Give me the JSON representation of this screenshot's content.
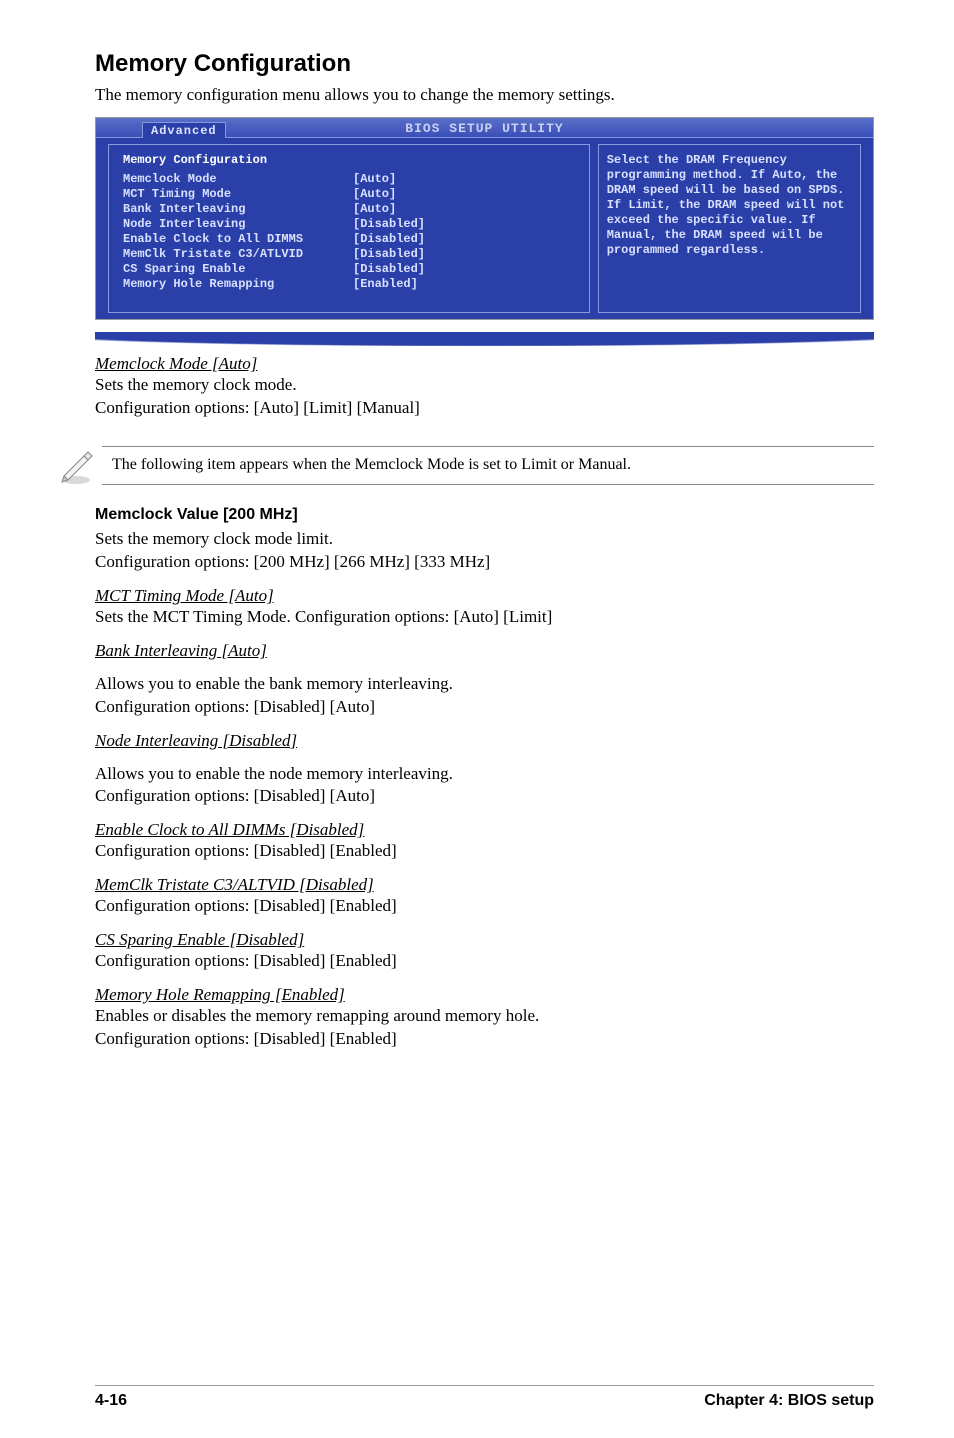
{
  "title": "Memory Configuration",
  "intro": "The memory configuration menu allows you to change the memory settings.",
  "bios": {
    "header": "BIOS SETUP UTILITY",
    "tab": "Advanced",
    "main_title": "Memory Configuration",
    "rows": [
      {
        "lbl": "Memclock Mode",
        "val": "[Auto]"
      },
      {
        "lbl": "MCT Timing Mode",
        "val": "[Auto]"
      },
      {
        "lbl": "Bank Interleaving",
        "val": "[Auto]"
      },
      {
        "lbl": "Node Interleaving",
        "val": "[Disabled]"
      },
      {
        "lbl": "Enable Clock to All DIMMS",
        "val": "[Disabled]"
      },
      {
        "lbl": "MemClk Tristate C3/ATLVID",
        "val": "[Disabled]"
      },
      {
        "lbl": "CS Sparing Enable",
        "val": "[Disabled]"
      },
      {
        "lbl": "Memory Hole Remapping",
        "val": "[Enabled]"
      }
    ],
    "help": "Select the DRAM Frequency programming method. If Auto, the DRAM speed will be based on SPDS. If Limit, the DRAM speed will not exceed the specific value. If Manual, the DRAM speed will be programmed regardless."
  },
  "items": {
    "memclock_mode_head": "Memclock Mode [Auto]",
    "memclock_mode_l1": "Sets the memory clock mode.",
    "memclock_mode_l2": "Configuration options: [Auto] [Limit] [Manual]",
    "note_text": "The following item appears when the Memclock Mode is set to Limit or Manual.",
    "memclock_value_head": "Memclock Value [200 MHz]",
    "memclock_value_l1": "Sets the memory clock mode limit.",
    "memclock_value_l2": "Configuration options: [200 MHz] [266 MHz] [333 MHz]",
    "mct_head": "MCT Timing Mode [Auto]",
    "mct_l1": "Sets the MCT Timing Mode. Configuration options: [Auto] [Limit]",
    "bank_head": "Bank Interleaving [Auto]",
    "bank_l1": "Allows you to enable the bank memory interleaving.",
    "bank_l2": "Configuration options: [Disabled] [Auto]",
    "node_head": "Node Interleaving [Disabled]",
    "node_l1": "Allows you to enable the node memory interleaving.",
    "node_l2": "Configuration options: [Disabled] [Auto]",
    "enclk_head": "Enable Clock to All DIMMs [Disabled]",
    "enclk_l1": "Configuration options: [Disabled] [Enabled]",
    "tristate_head": "MemClk Tristate C3/ALTVID [Disabled]",
    "tristate_l1": "Configuration options: [Disabled] [Enabled]",
    "cs_head": "CS Sparing Enable [Disabled]",
    "cs_l1": "Configuration options: [Disabled] [Enabled]",
    "hole_head": "Memory Hole Remapping [Enabled]",
    "hole_l1": "Enables or disables the memory remapping around memory hole.",
    "hole_l2": "Configuration options: [Disabled] [Enabled]"
  },
  "footer": {
    "left": "4-16",
    "right": "Chapter 4: BIOS setup"
  }
}
